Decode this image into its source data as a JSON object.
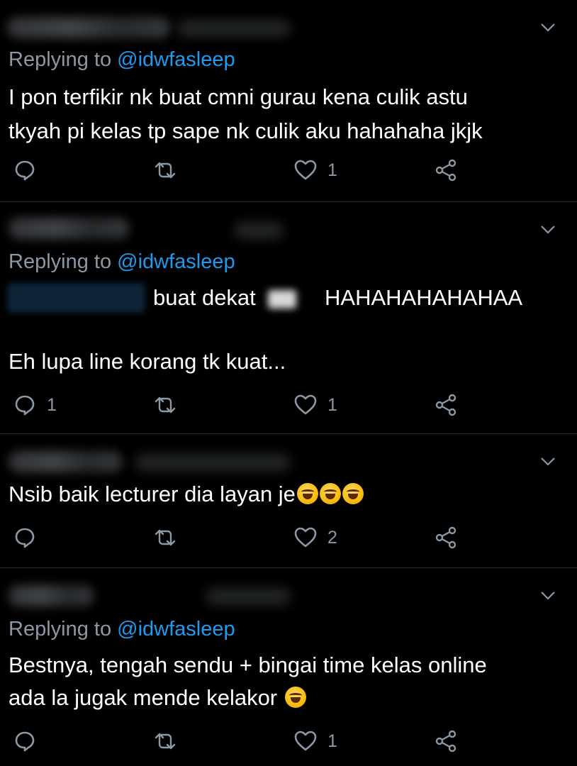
{
  "tweets": [
    {
      "replying_label": "Replying to",
      "replying_handle": "@idwfasleep",
      "lines": [
        "I pon terfikir nk buat cmni gurau kena culik astu",
        "tkyah pi kelas tp sape nk culik aku hahahaha jkjk"
      ],
      "reply_count": "",
      "like_count": "1"
    },
    {
      "replying_label": "Replying to",
      "replying_handle": "@idwfasleep",
      "line1_mid": "buat dekat",
      "line1_end": "HAHAHAHAHAHAA",
      "line2": "Eh lupa line korang tk kuat...",
      "reply_count": "1",
      "like_count": "1"
    },
    {
      "text": "Nsib baik lecturer dia layan je",
      "emoji": "rolling-on-floor-laughing x3",
      "reply_count": "",
      "like_count": "2"
    },
    {
      "replying_label": "Replying to",
      "replying_handle": "@idwfasleep",
      "lines": [
        "Bestnya, tengah sendu + bingai time kelas online",
        "ada la jugak mende kelakor"
      ],
      "emoji": "face-with-tears-of-joy",
      "reply_count": "",
      "like_count": "1"
    }
  ],
  "icons": {
    "reply": "reply-icon",
    "retweet": "retweet-icon",
    "like": "heart-icon",
    "share": "share-icon",
    "menu": "chevron-down-icon"
  },
  "colors": {
    "background": "#000000",
    "text": "#ffffff",
    "secondary": "#8b98a5",
    "mention": "#1d9bf0"
  }
}
